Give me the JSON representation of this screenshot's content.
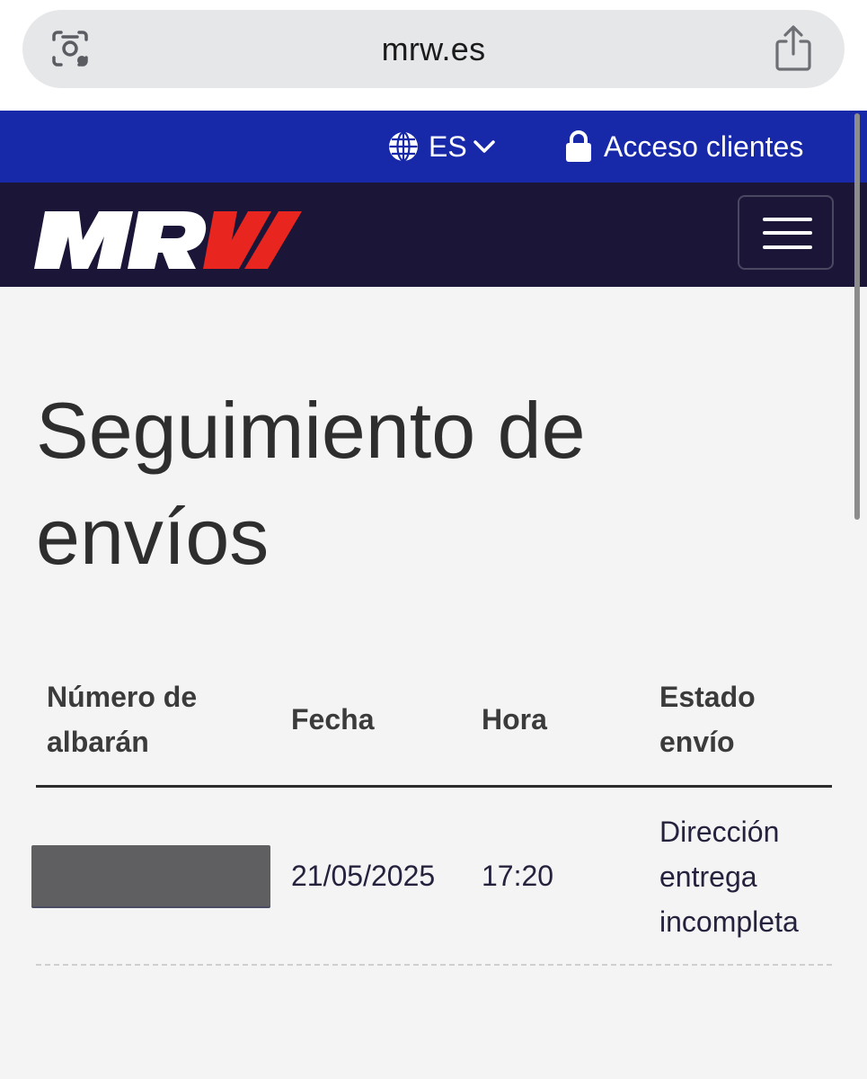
{
  "browser": {
    "url": "mrw.es",
    "lens_icon": "visual-search-icon",
    "share_icon": "share-icon"
  },
  "topbar": {
    "language": "ES",
    "language_icon": "globe-icon",
    "client_access": "Acceso clientes",
    "client_access_icon": "lock-icon"
  },
  "brand": {
    "logo_text": "MRW",
    "menu_icon": "hamburger-menu-icon",
    "colors": {
      "topbar": "#1729a8",
      "brandbar": "#1b1638",
      "accent_red": "#e8251f"
    }
  },
  "main": {
    "title": "Seguimiento de envíos",
    "table": {
      "columns": [
        "Número de albarán",
        "Fecha",
        "Hora",
        "Estado envío"
      ],
      "rows": [
        {
          "albaran": "",
          "fecha": "21/05/2025",
          "hora": "17:20",
          "estado": "Dirección entrega incompleta"
        }
      ]
    }
  }
}
